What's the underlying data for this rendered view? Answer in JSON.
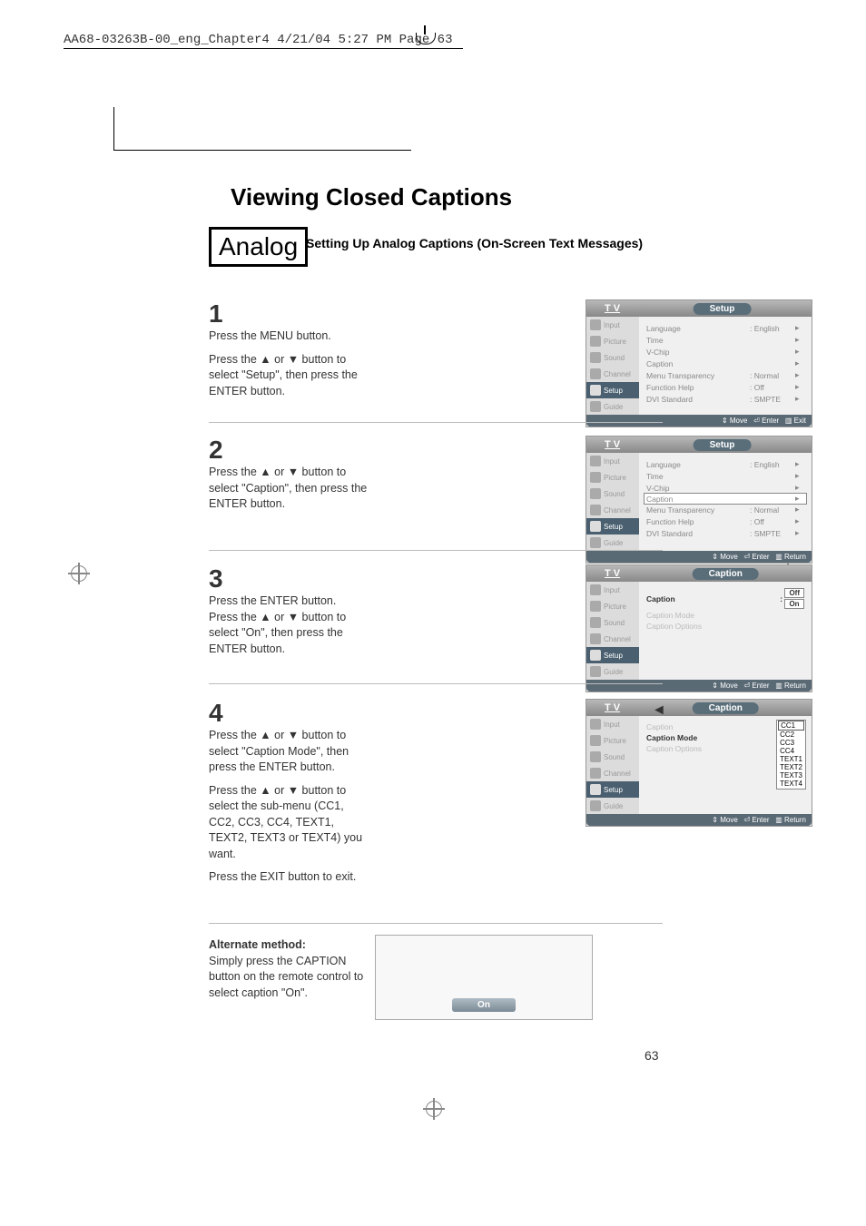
{
  "header": "AA68-03263B-00_eng_Chapter4  4/21/04  5:27 PM  Page 63",
  "title": "Viewing Closed Captions",
  "badge": "Analog",
  "subtitle": "Setting Up Analog Captions (On-Screen Text Messages)",
  "steps": {
    "s1": {
      "num": "1",
      "p1": "Press the MENU button.",
      "p2": "Press the ▲ or ▼ button to select \"Setup\", then press the ENTER button."
    },
    "s2": {
      "num": "2",
      "p1": "Press the ▲ or ▼ button to select \"Caption\", then press the ENTER button."
    },
    "s3": {
      "num": "3",
      "p1": "Press the ENTER button. Press the ▲ or ▼ button to select \"On\", then press the ENTER button."
    },
    "s4": {
      "num": "4",
      "p1": "Press the ▲ or ▼ button to select \"Caption Mode\", then press the ENTER button.",
      "p2": "Press the ▲ or ▼ button to select the sub-menu (CC1, CC2, CC3, CC4, TEXT1, TEXT2, TEXT3 or TEXT4) you want.",
      "p3": "Press the EXIT button to exit."
    }
  },
  "alternate": {
    "heading": "Alternate method:",
    "text": "Simply press the CAPTION button on the remote control to select caption \"On\"."
  },
  "menu": {
    "tv": "T V",
    "setup_title": "Setup",
    "caption_title": "Caption",
    "tabs": {
      "input": "Input",
      "picture": "Picture",
      "sound": "Sound",
      "channel": "Channel",
      "setup": "Setup",
      "guide": "Guide"
    },
    "setup_items": {
      "language": "Language",
      "language_val": ":  English",
      "time": "Time",
      "vchip": "V-Chip",
      "caption": "Caption",
      "menu_trans": "Menu Transparency",
      "menu_trans_val": ":  Normal",
      "func_help": "Function Help",
      "func_help_val": ":  Off",
      "dvi": "DVI Standard",
      "dvi_val": ":  SMPTE"
    },
    "caption_items": {
      "caption": "Caption",
      "caption_mode": "Caption Mode",
      "caption_options": "Caption Options",
      "off": "Off",
      "on": "On",
      "cc1": "CC1",
      "cc2": "CC2",
      "cc3": "CC3",
      "cc4": "CC4",
      "text1": "TEXT1",
      "text2": "TEXT2",
      "text3": "TEXT3",
      "text4": "TEXT4"
    },
    "footer": {
      "move": "Move",
      "enter": "Enter",
      "exit": "Exit",
      "return": "Return"
    }
  },
  "on_pill": "On",
  "page_num": "63"
}
